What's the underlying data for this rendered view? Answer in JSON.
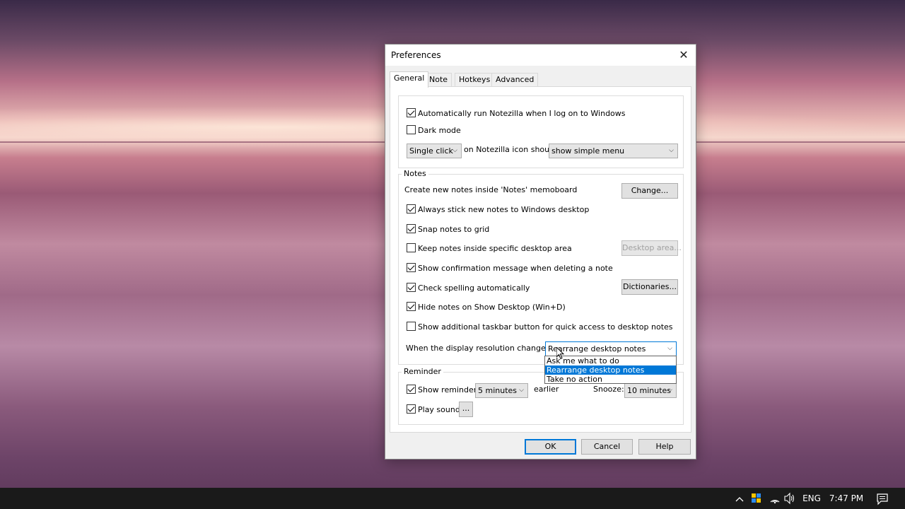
{
  "dialog": {
    "title": "Preferences",
    "close_glyph": "✕",
    "tabs": [
      {
        "label": "General",
        "active": true
      },
      {
        "label": "Note",
        "active": false
      },
      {
        "label": "Hotkeys",
        "active": false
      },
      {
        "label": "Advanced",
        "active": false
      }
    ],
    "general": {
      "auto_run": {
        "label": "Automatically run Notezilla when I log on to Windows",
        "checked": true
      },
      "dark_mode": {
        "label": "Dark mode",
        "checked": false
      },
      "click_select": {
        "value": "Single click"
      },
      "icon_text": "on Notezilla icon should",
      "menu_select": {
        "value": "show simple menu"
      }
    },
    "notes": {
      "group_label": "Notes",
      "create_text": "Create new notes inside 'Notes' memoboard",
      "change_button": "Change...",
      "always_stick": {
        "label": "Always stick new notes to Windows desktop",
        "checked": true
      },
      "snap_grid": {
        "label": "Snap notes to grid",
        "checked": true
      },
      "keep_inside": {
        "label": "Keep notes inside specific desktop area",
        "checked": false
      },
      "desktop_area_button": "Desktop area...",
      "confirm_delete": {
        "label": "Show confirmation message when deleting a note",
        "checked": true
      },
      "check_spelling": {
        "label": "Check spelling automatically",
        "checked": true
      },
      "dictionaries_button": "Dictionaries...",
      "hide_notes": {
        "label": "Hide notes on Show Desktop (Win+D)",
        "checked": true
      },
      "taskbar_button": {
        "label": "Show additional taskbar button for quick access to desktop notes",
        "checked": false
      },
      "resolution_label": "When the display resolution changes:",
      "resolution_select": {
        "value": "Rearrange desktop notes"
      },
      "resolution_options": [
        {
          "label": "Ask me what to do",
          "selected": false
        },
        {
          "label": "Rearrange desktop notes",
          "selected": true
        },
        {
          "label": "Take no action",
          "selected": false
        }
      ]
    },
    "reminder": {
      "group_label": "Reminder",
      "show_reminder": {
        "label": "Show reminder",
        "checked": true
      },
      "reminder_select": {
        "value": "5 minutes"
      },
      "earlier_text": "earlier",
      "snooze_label": "Snooze:",
      "snooze_select": {
        "value": "10 minutes"
      },
      "play_sound": {
        "label": "Play sound",
        "checked": true
      },
      "sound_button": "..."
    },
    "footer": {
      "ok": "OK",
      "cancel": "Cancel",
      "help": "Help"
    }
  },
  "taskbar": {
    "chevron_icon": "^",
    "language": "ENG",
    "time": "7:47 PM"
  }
}
